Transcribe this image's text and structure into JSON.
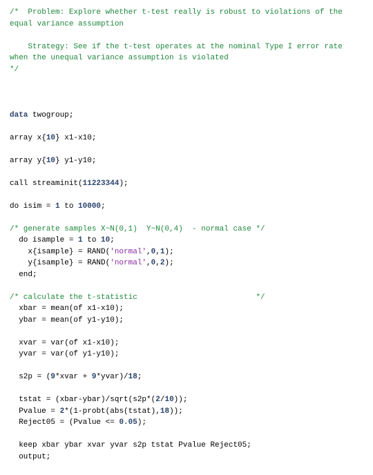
{
  "comment_block": "/*  Problem: Explore whether t-test really is robust to violations of the equal variance assumption\n\n    Strategy: See if the t-test operates at the nominal Type I error rate when the unequal variance assumption is violated\n*/",
  "l_data": {
    "kw": "data",
    "name": " twogroup;"
  },
  "l_arr_x": {
    "pre": "array x{",
    "n": "10",
    "post": "} x1-x10;"
  },
  "l_arr_y": {
    "pre": "array y{",
    "n": "10",
    "post": "} y1-y10;"
  },
  "l_call": {
    "pre": "call streaminit(",
    "n": "11223344",
    "post": ");"
  },
  "l_do_out": {
    "pre": "do isim = ",
    "a": "1",
    "mid": " to ",
    "b": "10000",
    "post": ";"
  },
  "c_gen": "/* generate samples X~N(0,1)  Y~N(0,4)  - normal case */",
  "l_do_in": {
    "pre": "  do isample = ",
    "a": "1",
    "mid": " to ",
    "b": "10",
    "post": ";"
  },
  "l_x": {
    "pre": "    x{isample} = RAND(",
    "s": "'normal'",
    "mid1": ",",
    "n1": "0",
    "mid2": ",",
    "n2": "1",
    "post": ");"
  },
  "l_y": {
    "pre": "    y{isample} = RAND(",
    "s": "'normal'",
    "mid1": ",",
    "n1": "0",
    "mid2": ",",
    "n2": "2",
    "post": ");"
  },
  "l_end1": "  end;",
  "c_calc": "/* calculate the t-statistic                          */",
  "l_xbar": "  xbar = mean(of x1-x10);",
  "l_ybar": "  ybar = mean(of y1-y10);",
  "l_xvar": "  xvar = var(of x1-x10);",
  "l_yvar": "  yvar = var(of y1-y10);",
  "l_s2p": {
    "pre": "  s2p = (",
    "a": "9",
    "mid1": "*xvar + ",
    "b": "9",
    "mid2": "*yvar)/",
    "c": "18",
    "post": ";"
  },
  "l_tstat": {
    "pre": "  tstat = (xbar-ybar)/sqrt(s2p*(",
    "a": "2",
    "mid": "/",
    "b": "10",
    "post": "));"
  },
  "l_pval": {
    "pre": "  Pvalue = ",
    "a": "2",
    "mid": "*(1-probt(abs(tstat),",
    "b": "18",
    "post": "));"
  },
  "l_rej": {
    "pre": "  Reject05 = (Pvalue <= ",
    "a": "0.05",
    "post": ");"
  },
  "l_keep": "  keep xbar ybar xvar yvar s2p tstat Pvalue Reject05;",
  "l_out": "  output;"
}
